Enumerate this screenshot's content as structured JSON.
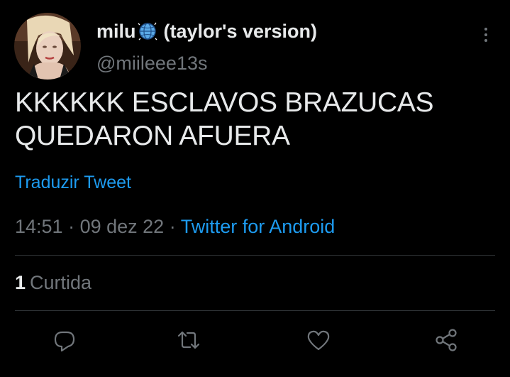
{
  "user": {
    "display_name": "milu",
    "name_suffix": "(taylor's version)",
    "name_emoji": "globe-with-meridians-emoji",
    "handle": "@miileee13s"
  },
  "tweet": {
    "text": "KKKKKK ESCLAVOS BRAZUCAS\nQUEDARON AFUERA",
    "translate_label": "Traduzir Tweet"
  },
  "meta": {
    "time": "14:51",
    "separator": " · ",
    "date": "09 dez 22",
    "source": "Twitter for Android"
  },
  "engagement": {
    "likes_count": "1",
    "likes_label": "Curtida"
  },
  "actions": {
    "reply_icon": "reply-icon",
    "retweet_icon": "retweet-icon",
    "like_icon": "heart-icon",
    "share_icon": "share-icon"
  },
  "colors": {
    "background": "#000000",
    "text_primary": "#e7e9ea",
    "text_secondary": "#71767b",
    "accent": "#1d9bf0",
    "divider": "#2f3336"
  }
}
